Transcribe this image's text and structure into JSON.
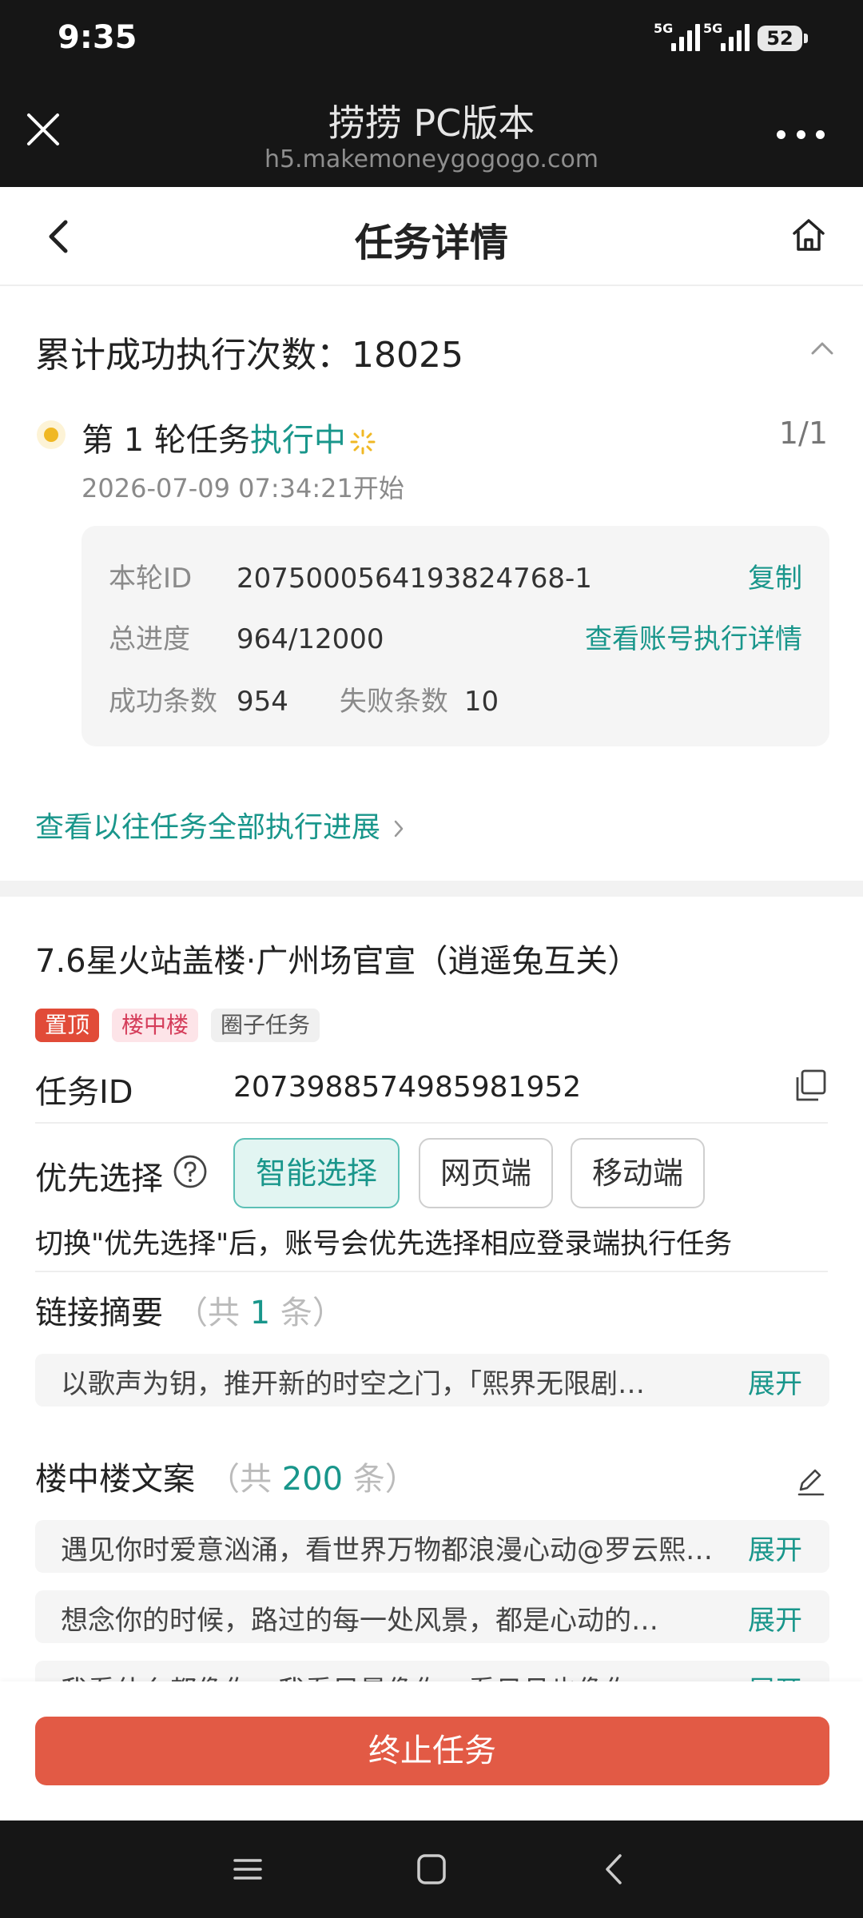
{
  "status_bar": {
    "time": "9:35",
    "signal1": "5G",
    "signal2": "5G",
    "battery": "52"
  },
  "browser": {
    "title": "捞捞 PC版本",
    "url": "h5.makemoneygogogo.com"
  },
  "nav": {
    "title": "任务详情"
  },
  "summary": {
    "cumulative_label": "累计成功执行次数：",
    "cumulative_value": "18025",
    "round_prefix": "第 1 轮任务",
    "round_status": "执行中",
    "round_count": "1/1",
    "round_start": "2026-07-09 07:34:21开始",
    "id_label": "本轮ID",
    "id_value": "2075000564193824768-1",
    "copy_label": "复制",
    "progress_label": "总进度",
    "progress_value": "964/12000",
    "detail_link": "查看账号执行详情",
    "success_label": "成功条数",
    "success_value": "954",
    "fail_label": "失败条数",
    "fail_value": "10",
    "history_link": "查看以往任务全部执行进展"
  },
  "task": {
    "title": "7.6星火站盖楼·广州场官宣（逍遥兔互关）",
    "tags": [
      "置顶",
      "楼中楼",
      "圈子任务"
    ],
    "id_label": "任务ID",
    "id_value": "2073988574985981952",
    "priority_label": "优先选择",
    "priority_options": [
      "智能选择",
      "网页端",
      "移动端"
    ],
    "priority_selected": "智能选择",
    "priority_note": "切换\"优先选择\"后，账号会优先选择相应登录端执行任务",
    "links_label": "链接摘要",
    "links_meta_pre": "（共",
    "links_count": "1",
    "links_meta_post": "条）",
    "links_items": [
      {
        "text": "以歌声为钥，推开新的时空之门，「熙界无限剧…",
        "action": "展开"
      }
    ],
    "copy_label": "楼中楼文案",
    "copy_meta_pre": "（共",
    "copy_count": "200",
    "copy_meta_post": "条）",
    "copy_items": [
      {
        "text": "遇见你时爱意汹涌，看世界万物都浪漫心动@罗云熙…",
        "action": "展开"
      },
      {
        "text": "想念你的时候，路过的每一处风景，都是心动的…",
        "action": "展开"
      },
      {
        "text": "我看什么都像你，我看风景像你，看日月也像你",
        "action": "展开"
      }
    ]
  },
  "footer": {
    "stop_button": "终止任务"
  },
  "colors": {
    "accent": "#19968b",
    "danger": "#e25a45",
    "pin_tag": "#e14b38",
    "dark_bar": "#161616"
  }
}
